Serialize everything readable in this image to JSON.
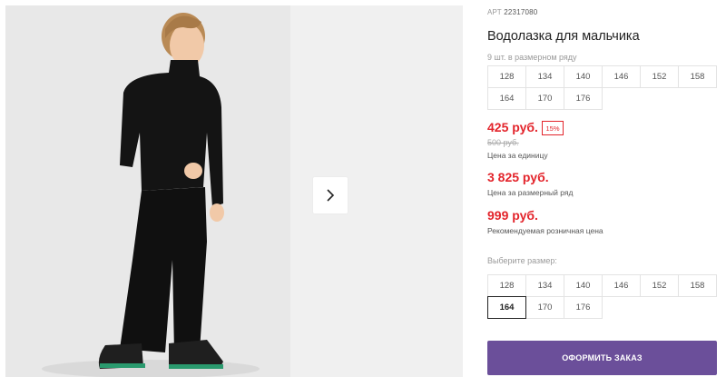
{
  "product": {
    "article_prefix": "АРТ",
    "article_number": "22317080",
    "title": "Водолазка для мальчика"
  },
  "size_row": {
    "caption": "9 шт. в размерном ряду",
    "sizes": [
      "128",
      "134",
      "140",
      "146",
      "152",
      "158",
      "164",
      "170",
      "176"
    ]
  },
  "pricing": {
    "unit_price": "425 руб.",
    "discount_badge": "15%",
    "old_price": "500 руб.",
    "unit_caption": "Цена за единицу",
    "row_price": "3 825 руб.",
    "row_caption": "Цена за размерный ряд",
    "retail_price": "999 руб.",
    "retail_caption": "Рекомендуемая розничная цена"
  },
  "size_select": {
    "caption": "Выберите размер:",
    "sizes": [
      "128",
      "134",
      "140",
      "146",
      "152",
      "158",
      "164",
      "170",
      "176"
    ],
    "selected": "164"
  },
  "actions": {
    "order_label": "ОФОРМИТЬ ЗАКАЗ"
  },
  "colors": {
    "price_red": "#e3242b",
    "order_button": "#6b4f9a"
  },
  "icons": {
    "next": "chevron-right-icon"
  }
}
